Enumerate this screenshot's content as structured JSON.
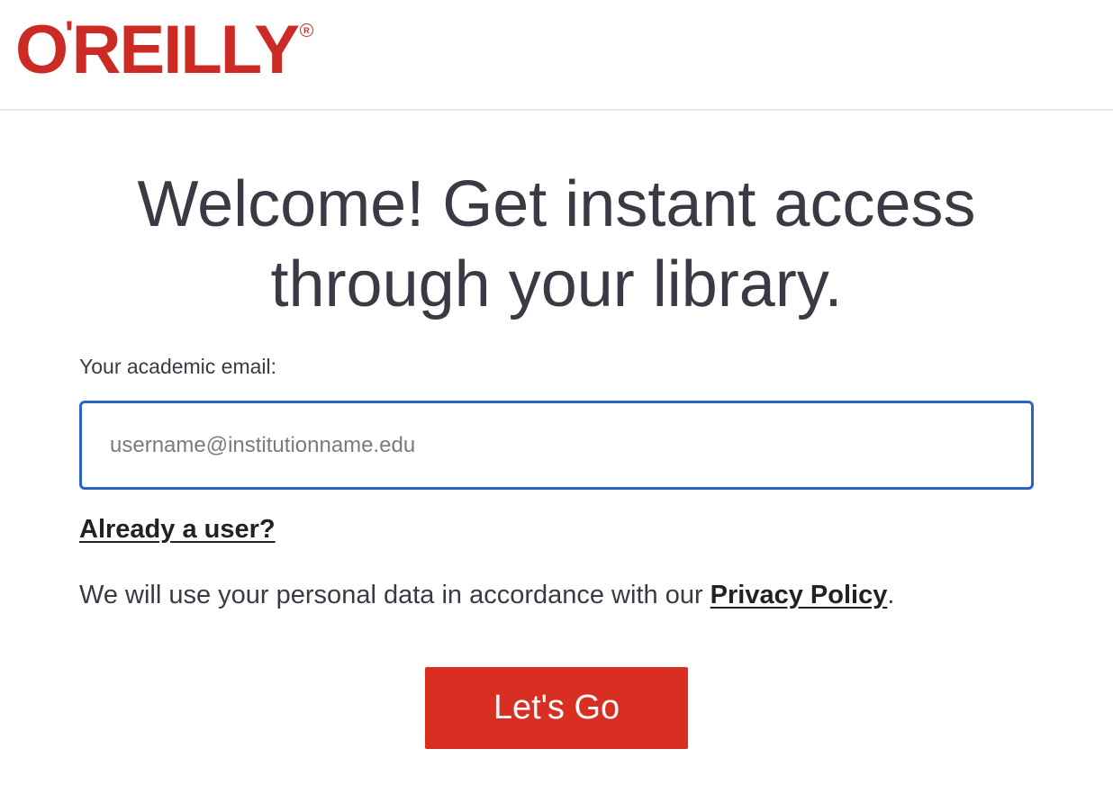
{
  "brand": {
    "logo_text": "O'REILLY",
    "logo_o": "O",
    "logo_apostrophe": "'",
    "logo_rest": "REILLY",
    "logo_registered": "R",
    "color": "#cc2b25"
  },
  "main": {
    "headline_line1": "Welcome! Get instant access",
    "headline_line2": "through your library.",
    "email_label": "Your academic email:",
    "email_placeholder": "username@institutionname.edu",
    "email_value": "",
    "already_user_link": "Already a user?",
    "privacy_prefix": "We will use your personal data in accordance with our ",
    "privacy_link": "Privacy Policy",
    "privacy_suffix": ".",
    "submit_label": "Let's Go"
  },
  "colors": {
    "accent_button": "#d92e22",
    "input_focus_border": "#2a63c6",
    "text": "#3a3a45"
  }
}
